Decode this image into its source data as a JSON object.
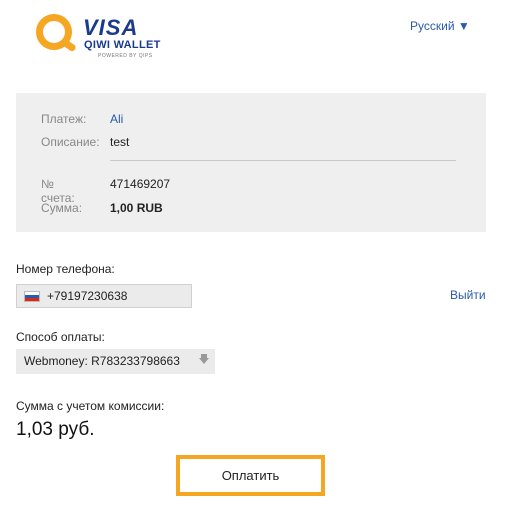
{
  "brand": {
    "visa": "VISA",
    "qiwi": "QIWI WALLET",
    "powered": "POWERED BY QIPS"
  },
  "language": {
    "selected": "Русский",
    "arrow": "▼"
  },
  "payment_info": {
    "payment_label": "Платеж:",
    "payment_value": "Ali",
    "description_label": "Описание:",
    "description_value": "test",
    "account_label": "№ счета:",
    "account_value": "471469207",
    "sum_label": "Сумма:",
    "sum_value": "1,00 RUB"
  },
  "phone": {
    "label": "Номер телефона:",
    "value": "+79197230638",
    "logout": "Выйти"
  },
  "payment_method": {
    "label": "Способ оплаты:",
    "selected": "Webmoney:  R783233798663"
  },
  "total": {
    "label": "Сумма с учетом комиссии:",
    "value": "1,03 руб."
  },
  "submit": {
    "label": "Оплатить"
  },
  "colors": {
    "accent": "#f5a623",
    "brand_blue": "#1a3a8c",
    "link": "#2a5aa8",
    "panel": "#efefef"
  }
}
